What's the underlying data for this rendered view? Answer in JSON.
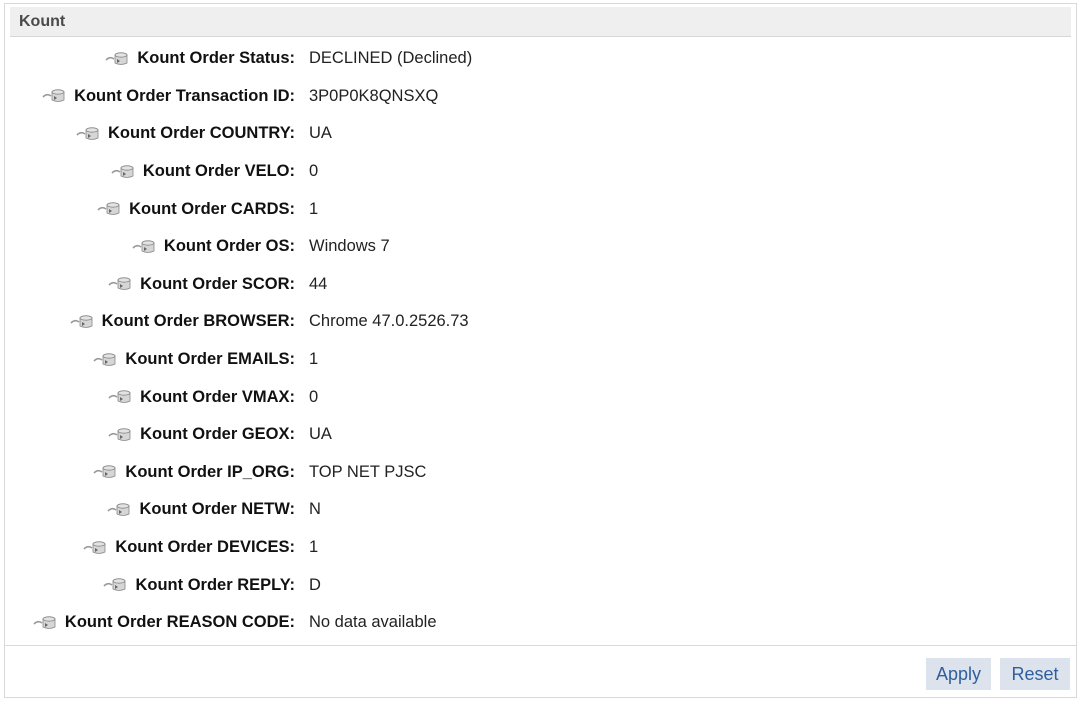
{
  "panel": {
    "title": "Kount"
  },
  "rows": [
    {
      "label": "Kount Order Status:",
      "value": "DECLINED (Declined)",
      "icon": "database-link-icon"
    },
    {
      "label": "Kount Order Transaction ID:",
      "value": "3P0P0K8QNSXQ",
      "icon": "database-link-icon"
    },
    {
      "label": "Kount Order COUNTRY:",
      "value": "UA",
      "icon": "database-link-icon"
    },
    {
      "label": "Kount Order VELO:",
      "value": "0",
      "icon": "database-link-icon"
    },
    {
      "label": "Kount Order CARDS:",
      "value": "1",
      "icon": "database-link-icon"
    },
    {
      "label": "Kount Order OS:",
      "value": "Windows 7",
      "icon": "database-link-icon"
    },
    {
      "label": "Kount Order SCOR:",
      "value": "44",
      "icon": "database-link-icon"
    },
    {
      "label": "Kount Order BROWSER:",
      "value": "Chrome 47.0.2526.73",
      "icon": "database-link-icon"
    },
    {
      "label": "Kount Order EMAILS:",
      "value": "1",
      "icon": "database-link-icon"
    },
    {
      "label": "Kount Order VMAX:",
      "value": "0",
      "icon": "database-link-icon"
    },
    {
      "label": "Kount Order GEOX:",
      "value": "UA",
      "icon": "database-link-icon"
    },
    {
      "label": "Kount Order IP_ORG:",
      "value": "TOP NET PJSC",
      "icon": "database-link-icon"
    },
    {
      "label": "Kount Order NETW:",
      "value": "N",
      "icon": "database-link-icon"
    },
    {
      "label": "Kount Order DEVICES:",
      "value": "1",
      "icon": "database-link-icon"
    },
    {
      "label": "Kount Order REPLY:",
      "value": "D",
      "icon": "database-link-icon"
    },
    {
      "label": "Kount Order REASON CODE:",
      "value": "No data available",
      "icon": "database-link-icon"
    }
  ],
  "footer": {
    "apply_label": "Apply",
    "reset_label": "Reset"
  },
  "colors": {
    "header_bg": "#efefef",
    "button_bg": "#dde3ec",
    "button_text": "#2f5f9e"
  }
}
